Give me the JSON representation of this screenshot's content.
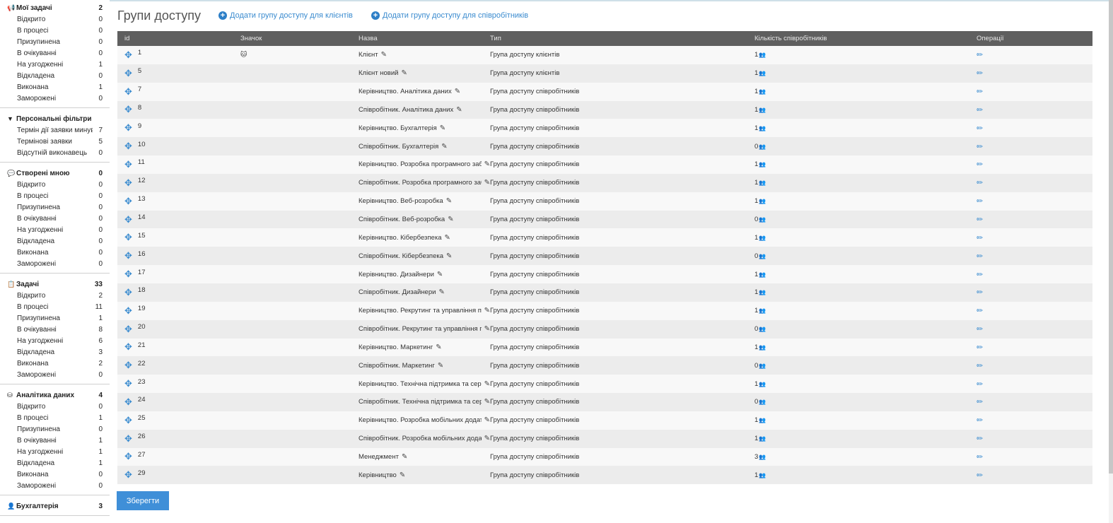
{
  "sidebar": {
    "sections": [
      {
        "name": "Мої задачі",
        "icon": "megaphone-icon",
        "glyph": "📢",
        "count": "2",
        "items": [
          [
            "Відкрито",
            "0"
          ],
          [
            "В процесі",
            "0"
          ],
          [
            "Призупинена",
            "0"
          ],
          [
            "В очікуванні",
            "0"
          ],
          [
            "На узгодженні",
            "1"
          ],
          [
            "Відкладена",
            "0"
          ],
          [
            "Виконана",
            "1"
          ],
          [
            "Заморожені",
            "0"
          ]
        ]
      },
      {
        "name": "Персональні фільтри",
        "icon": "filter-icon",
        "glyph": "▼",
        "count": "",
        "items": [
          [
            "Термін дії заявки минув",
            "7"
          ],
          [
            "Термінові заявки",
            "5"
          ],
          [
            "Відсутній виконавець",
            "0"
          ]
        ]
      },
      {
        "name": "Створені мною",
        "icon": "comment-icon",
        "glyph": "💬",
        "count": "0",
        "items": [
          [
            "Відкрито",
            "0"
          ],
          [
            "В процесі",
            "0"
          ],
          [
            "Призупинена",
            "0"
          ],
          [
            "В очікуванні",
            "0"
          ],
          [
            "На узгодженні",
            "0"
          ],
          [
            "Відкладена",
            "0"
          ],
          [
            "Виконана",
            "0"
          ],
          [
            "Заморожені",
            "0"
          ]
        ]
      },
      {
        "name": "Задачі",
        "icon": "clipboard-icon",
        "glyph": "📋",
        "count": "33",
        "items": [
          [
            "Відкрито",
            "2"
          ],
          [
            "В процесі",
            "11"
          ],
          [
            "Призупинена",
            "1"
          ],
          [
            "В очікуванні",
            "8"
          ],
          [
            "На узгодженні",
            "6"
          ],
          [
            "Відкладена",
            "3"
          ],
          [
            "Виконана",
            "2"
          ],
          [
            "Заморожені",
            "0"
          ]
        ]
      },
      {
        "name": "Аналітика даних",
        "icon": "database-icon",
        "glyph": "⛁",
        "count": "4",
        "items": [
          [
            "Відкрито",
            "0"
          ],
          [
            "В процесі",
            "1"
          ],
          [
            "Призупинена",
            "0"
          ],
          [
            "В очікуванні",
            "1"
          ],
          [
            "На узгодженні",
            "1"
          ],
          [
            "Відкладена",
            "1"
          ],
          [
            "Виконана",
            "0"
          ],
          [
            "Заморожені",
            "0"
          ]
        ]
      },
      {
        "name": "Бухгалтерія",
        "icon": "user-icon",
        "glyph": "👤",
        "count": "3",
        "items": []
      }
    ]
  },
  "page": {
    "title": "Групи доступу",
    "add_client": "Додати групу доступу для клієнтів",
    "add_employee": "Додати групу доступу для співробітників",
    "save": "Зберегти"
  },
  "table": {
    "headers": {
      "id": "id",
      "icon": "Значок",
      "name": "Назва",
      "type": "Тип",
      "count": "Кількість співробітників",
      "ops": "Операції"
    },
    "rows": [
      {
        "id": "1",
        "icon": "🐱",
        "name": "Клієнт",
        "type": "Група доступу клієнтів",
        "count": "1"
      },
      {
        "id": "5",
        "icon": "",
        "name": "Клієнт новий",
        "type": "Група доступу клієнтів",
        "count": "1"
      },
      {
        "id": "7",
        "icon": "",
        "name": "Керівництво. Аналітика даних",
        "type": "Група доступу співробітників",
        "count": "1"
      },
      {
        "id": "8",
        "icon": "",
        "name": "Співробітник. Аналітика даних",
        "type": "Група доступу співробітників",
        "count": "1"
      },
      {
        "id": "9",
        "icon": "",
        "name": "Керівництво. Бухгалтерія",
        "type": "Група доступу співробітників",
        "count": "1"
      },
      {
        "id": "10",
        "icon": "",
        "name": "Співробітник. Бухгалтерія",
        "type": "Група доступу співробітників",
        "count": "0"
      },
      {
        "id": "11",
        "icon": "",
        "name": "Керівництво. Розробка програмного забезпечення",
        "type": "Група доступу співробітників",
        "count": "1"
      },
      {
        "id": "12",
        "icon": "",
        "name": "Співробітник. Розробка програмного забезпечення",
        "type": "Група доступу співробітників",
        "count": "1"
      },
      {
        "id": "13",
        "icon": "",
        "name": "Керівництво. Веб-розробка",
        "type": "Група доступу співробітників",
        "count": "1"
      },
      {
        "id": "14",
        "icon": "",
        "name": "Співробітник. Веб-розробка",
        "type": "Група доступу співробітників",
        "count": "0"
      },
      {
        "id": "15",
        "icon": "",
        "name": "Керівництво. Кібербезпека",
        "type": "Група доступу співробітників",
        "count": "1"
      },
      {
        "id": "16",
        "icon": "",
        "name": "Співробітник. Кібербезпека",
        "type": "Група доступу співробітників",
        "count": "0"
      },
      {
        "id": "17",
        "icon": "",
        "name": "Керівництво. Дизайнери",
        "type": "Група доступу співробітників",
        "count": "1"
      },
      {
        "id": "18",
        "icon": "",
        "name": "Співробітник. Дизайнери",
        "type": "Група доступу співробітників",
        "count": "1"
      },
      {
        "id": "19",
        "icon": "",
        "name": "Керівництво. Рекрутинг та управління персоналом",
        "type": "Група доступу співробітників",
        "count": "1"
      },
      {
        "id": "20",
        "icon": "",
        "name": "Співробітник. Рекрутинг та управління персоналом",
        "type": "Група доступу співробітників",
        "count": "0"
      },
      {
        "id": "21",
        "icon": "",
        "name": "Керівництво. Маркетинг",
        "type": "Група доступу співробітників",
        "count": "1"
      },
      {
        "id": "22",
        "icon": "",
        "name": "Співробітник. Маркетинг",
        "type": "Група доступу співробітників",
        "count": "0"
      },
      {
        "id": "23",
        "icon": "",
        "name": "Керівництво. Технічна підтримка та сервіс",
        "type": "Група доступу співробітників",
        "count": "1"
      },
      {
        "id": "24",
        "icon": "",
        "name": "Співробітник. Технічна підтримка та сервіс",
        "type": "Група доступу співробітників",
        "count": "0"
      },
      {
        "id": "25",
        "icon": "",
        "name": "Керівництво. Розробка мобільних додатків",
        "type": "Група доступу співробітників",
        "count": "1"
      },
      {
        "id": "26",
        "icon": "",
        "name": "Співробітник. Розробка мобільних додатків",
        "type": "Група доступу співробітників",
        "count": "1"
      },
      {
        "id": "27",
        "icon": "",
        "name": "Менеджмент",
        "type": "Група доступу співробітників",
        "count": "3"
      },
      {
        "id": "29",
        "icon": "",
        "name": "Керівництво",
        "type": "Група доступу співробітників",
        "count": "1"
      }
    ]
  }
}
